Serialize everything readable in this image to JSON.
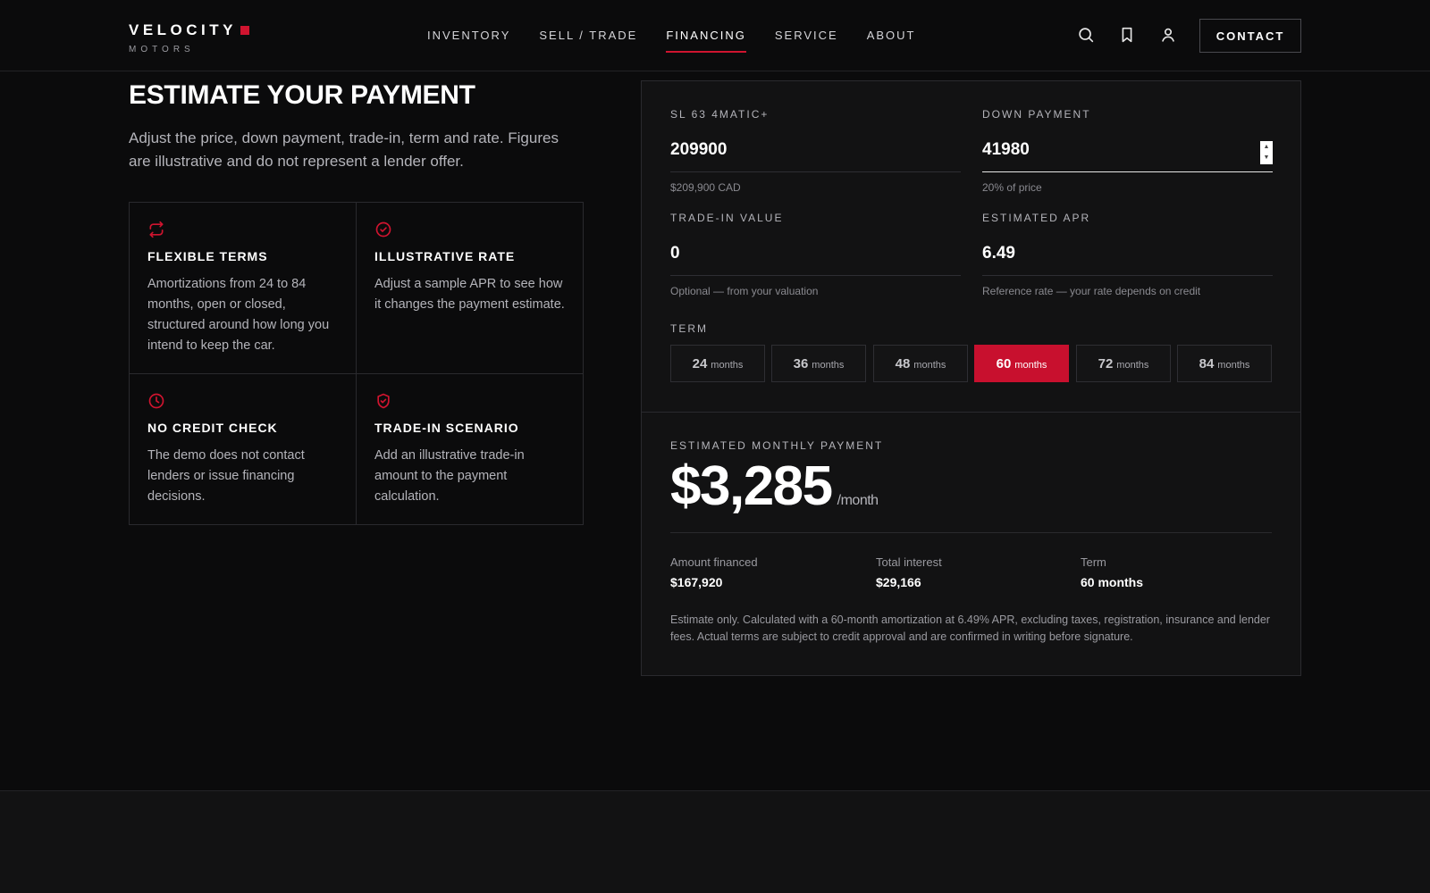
{
  "brand": {
    "name": "VELOCITY",
    "tagline": "MOTORS",
    "accent": "#d0142f"
  },
  "nav": {
    "items": [
      {
        "label": "INVENTORY",
        "active": false
      },
      {
        "label": "SELL / TRADE",
        "active": false
      },
      {
        "label": "FINANCING",
        "active": true
      },
      {
        "label": "SERVICE",
        "active": false
      },
      {
        "label": "ABOUT",
        "active": false
      }
    ],
    "icons": [
      "search-icon",
      "bookmark-icon",
      "user-icon"
    ],
    "contact_label": "CONTACT"
  },
  "intro": {
    "title": "ESTIMATE YOUR PAYMENT",
    "description": "Adjust the price, down payment, trade-in, term and rate. Figures are illustrative and do not represent a lender offer."
  },
  "features": [
    {
      "icon": "repeat-icon",
      "title": "FLEXIBLE TERMS",
      "text": "Amortizations from 24 to 84 months, open or closed, structured around how long you intend to keep the car."
    },
    {
      "icon": "check-circle-icon",
      "title": "ILLUSTRATIVE RATE",
      "text": "Adjust a sample APR to see how it changes the payment estimate."
    },
    {
      "icon": "clock-icon",
      "title": "NO CREDIT CHECK",
      "text": "The demo does not contact lenders or issue financing decisions."
    },
    {
      "icon": "shield-check-icon",
      "title": "TRADE-IN SCENARIO",
      "text": "Add an illustrative trade-in amount to the payment calculation."
    }
  ],
  "calculator": {
    "price": {
      "label": "SL 63 4MATIC+",
      "value": "209900",
      "hint": "$209,900 CAD"
    },
    "down_payment": {
      "label": "DOWN PAYMENT",
      "value": "41980",
      "hint": "20% of price"
    },
    "trade_in": {
      "label": "TRADE-IN VALUE",
      "value": "0",
      "hint": "Optional — from your valuation"
    },
    "apr": {
      "label": "ESTIMATED APR",
      "value": "6.49",
      "hint": "Reference rate — your rate depends on credit"
    },
    "term_label": "TERM",
    "terms": [
      {
        "num": "24",
        "unit": "months",
        "active": false
      },
      {
        "num": "36",
        "unit": "months",
        "active": false
      },
      {
        "num": "48",
        "unit": "months",
        "active": false
      },
      {
        "num": "60",
        "unit": "months",
        "active": true
      },
      {
        "num": "72",
        "unit": "months",
        "active": false
      },
      {
        "num": "84",
        "unit": "months",
        "active": false
      }
    ]
  },
  "result": {
    "label": "ESTIMATED MONTHLY PAYMENT",
    "amount": "$3,285",
    "per": "/month",
    "summary": [
      {
        "label": "Amount financed",
        "value": "$167,920"
      },
      {
        "label": "Total interest",
        "value": "$29,166"
      },
      {
        "label": "Term",
        "value": "60 months"
      }
    ],
    "disclaimer": "Estimate only. Calculated with a 60-month amortization at 6.49% APR, excluding taxes, registration, insurance and lender fees. Actual terms are subject to credit approval and are confirmed in writing before signature."
  }
}
